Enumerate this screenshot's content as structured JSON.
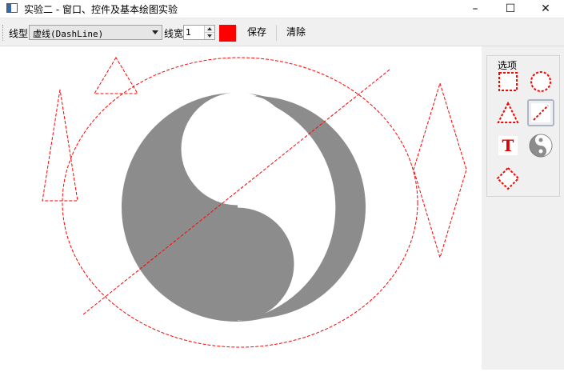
{
  "window": {
    "title": "实验二 - 窗口、控件及基本绘图实验",
    "controls": {
      "minimize": "–",
      "maximize": "☐",
      "close": "✕"
    }
  },
  "toolbar": {
    "line_style_label": "线型",
    "line_style_value": "虚线(DashLine)",
    "line_width_label": "线宽",
    "line_width_value": "1",
    "pen_color": "#ff0000",
    "save_label": "保存",
    "clear_label": "清除"
  },
  "dock": {
    "title": "选项",
    "tools": [
      {
        "name": "rectangle-tool-icon",
        "selected": false
      },
      {
        "name": "ellipse-tool-icon",
        "selected": false
      },
      {
        "name": "triangle-tool-icon",
        "selected": false
      },
      {
        "name": "line-tool-icon",
        "selected": true
      },
      {
        "name": "text-tool-icon",
        "glyph": "T",
        "selected": false
      },
      {
        "name": "taiji-tool-icon",
        "selected": false
      },
      {
        "name": "diamond-tool-icon",
        "selected": false
      }
    ]
  },
  "colors": {
    "stroke": "#ff0000",
    "taiji_dark": "#8c8c8c",
    "taiji_light": "#ffffff",
    "dock_bg": "#f0f0f0"
  }
}
